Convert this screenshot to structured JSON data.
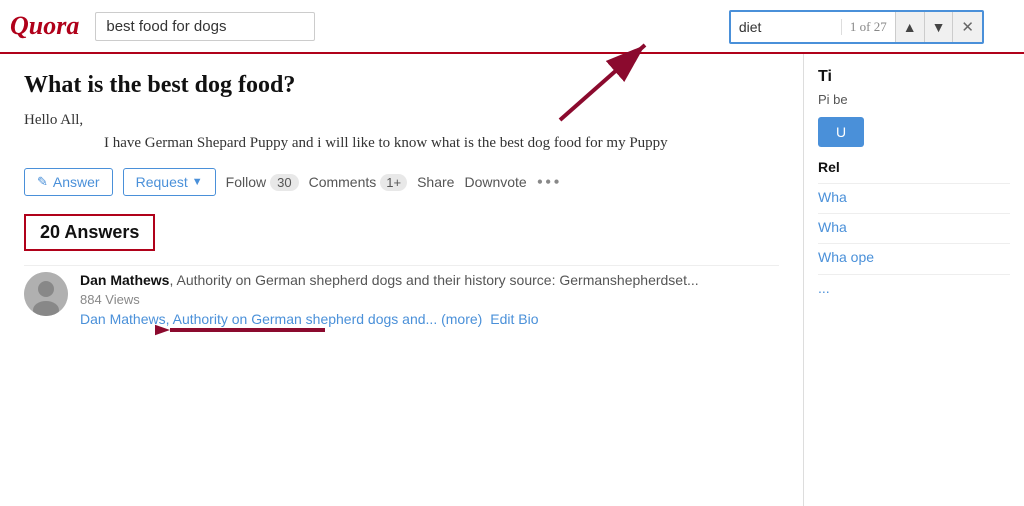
{
  "logo": {
    "text": "Quora"
  },
  "search": {
    "value": "best food for dogs",
    "placeholder": "best food for dogs"
  },
  "find_bar": {
    "value": "diet",
    "count": "1 of 27",
    "prev_label": "▲",
    "next_label": "▼",
    "close_label": "✕"
  },
  "question": {
    "title": "What is the best dog food?",
    "body_intro": "Hello All,",
    "body_detail": "I have German Shepard Puppy and i will like to know what is the best dog food for my Puppy"
  },
  "actions": {
    "answer_label": "Answer",
    "request_label": "Request",
    "follow_label": "Follow",
    "follow_count": "30",
    "comments_label": "Comments",
    "comments_count": "1+",
    "share_label": "Share",
    "downvote_label": "Downvote",
    "more_label": "•••"
  },
  "answers_section": {
    "count_label": "20 Answers"
  },
  "top_answer": {
    "author": "Dan Mathews",
    "bio": ", Authority on German shepherd dogs and their history source: Germanshepherdset...",
    "views": "884 Views",
    "preview": "Dan Mathews, Authority on German shepherd dogs and...",
    "more_label": "(more)",
    "edit_label": "Edit Bio"
  },
  "sidebar": {
    "title": "Ti",
    "desc": "Pi be",
    "cta_label": "U",
    "related_title": "Rel",
    "related_items": [
      {
        "text": "Wha"
      },
      {
        "text": "Wha"
      },
      {
        "text": "Wha ope"
      },
      {
        "text": "..."
      }
    ]
  }
}
